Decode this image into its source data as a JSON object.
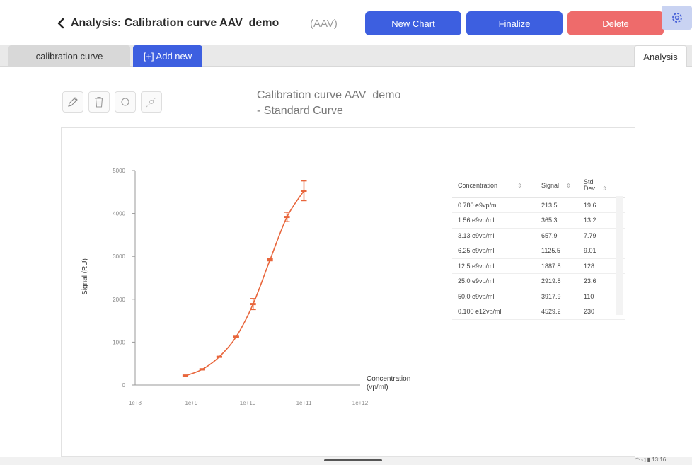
{
  "header": {
    "title": "Analysis: Calibration curve AAV  demo",
    "subtitle": "(AAV)",
    "buttons": {
      "new_chart": "New Chart",
      "finalize": "Finalize",
      "delete": "Delete"
    }
  },
  "tabs": {
    "calibration": "calibration curve",
    "add_new": "[+] Add new",
    "analysis": "Analysis"
  },
  "chart_title_line1": "Calibration curve AAV  demo",
  "chart_title_line2": "- Standard Curve",
  "table": {
    "headers": [
      "Concentration",
      "Signal",
      "Std Dev"
    ],
    "rows": [
      [
        "0.780 e9vp/ml",
        "213.5",
        "19.6"
      ],
      [
        "1.56 e9vp/ml",
        "365.3",
        "13.2"
      ],
      [
        "3.13 e9vp/ml",
        "657.9",
        "7.79"
      ],
      [
        "6.25 e9vp/ml",
        "1125.5",
        "9.01"
      ],
      [
        "12.5 e9vp/ml",
        "1887.8",
        "128"
      ],
      [
        "25.0 e9vp/ml",
        "2919.8",
        "23.6"
      ],
      [
        "50.0 e9vp/ml",
        "3917.9",
        "110"
      ],
      [
        "0.100 e12vp/ml",
        "4529.2",
        "230"
      ]
    ]
  },
  "status": {
    "time": "13:16"
  },
  "colors": {
    "accent": "#3d5fe0",
    "danger": "#ee6b6b",
    "curve": "#e8663c"
  },
  "chart_data": {
    "type": "scatter",
    "xlabel": "Concentration\n(vp/ml)",
    "ylabel": "Signal (RU)",
    "x_scale": "log",
    "xlim": [
      100000000,
      1000000000000
    ],
    "ylim": [
      0,
      5000
    ],
    "x_ticks": [
      "1e+8",
      "1e+9",
      "1e+10",
      "1e+11",
      "1e+12"
    ],
    "y_ticks": [
      "0",
      "1000",
      "2000",
      "3000",
      "4000",
      "5000"
    ],
    "series": [
      {
        "x": [
          780000000,
          1560000000,
          3130000000,
          6250000000,
          12500000000,
          25000000000,
          50000000000,
          100000000000
        ],
        "y": [
          213.5,
          365.3,
          657.9,
          1125.5,
          1887.8,
          2919.8,
          3917.9,
          4529.2
        ],
        "error": [
          19.6,
          13.2,
          7.79,
          9.01,
          128,
          23.6,
          110,
          230
        ]
      }
    ]
  }
}
